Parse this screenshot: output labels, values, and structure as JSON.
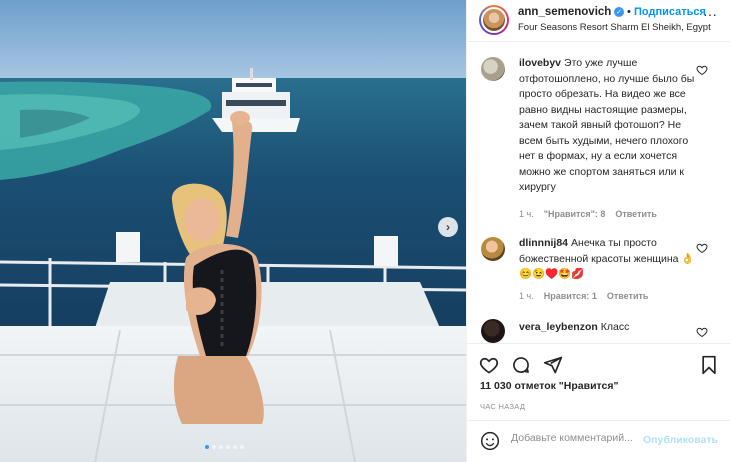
{
  "post": {
    "username": "ann_semenovich",
    "follow_label": "Подписаться",
    "separator": "•",
    "location": "Four Seasons Resort Sharm El Sheikh, Egypt",
    "more_label": "···",
    "verified_mark": "✓",
    "slide_count": 6,
    "active_slide": 1,
    "next_label": "›"
  },
  "comments": [
    {
      "user": "ilovebyv",
      "text": "Это уже лучше отфотошоплено, но лучше было бы просто обрезать. На видео же все равно видны настоящие размеры, зачем такой явный фотошоп? Не всем быть худыми, нечего плохого нет в формах, ну а если хочется можно же спортом заняться или к хирургу",
      "time": "1 ч.",
      "likes": "\"Нравится\": 8",
      "reply": "Ответить"
    },
    {
      "user": "dlinnnij84",
      "text": "Анечка ты просто божественной красоты женщина 👌😊😉♥️🤩💋",
      "time": "1 ч.",
      "likes": "Нравится: 1",
      "reply": "Ответить"
    },
    {
      "user": "vera_leybenzon",
      "text": "Класс"
    }
  ],
  "actions": {
    "likes_text": "11 030 отметок \"Нравится\"",
    "time_ago": "ЧАС НАЗАД"
  },
  "add_comment": {
    "placeholder": "Добавьте комментарий...",
    "publish_label": "Опубликовать"
  },
  "colors": {
    "accent": "#0095f6",
    "verified": "#3897f0",
    "muted": "#8e8e8e",
    "publish_disabled": "#b2dffc"
  },
  "icons": [
    "heart-icon",
    "comment-icon",
    "share-icon",
    "bookmark-icon",
    "emoji-icon",
    "verified-icon",
    "more-icon",
    "chevron-right-icon"
  ]
}
